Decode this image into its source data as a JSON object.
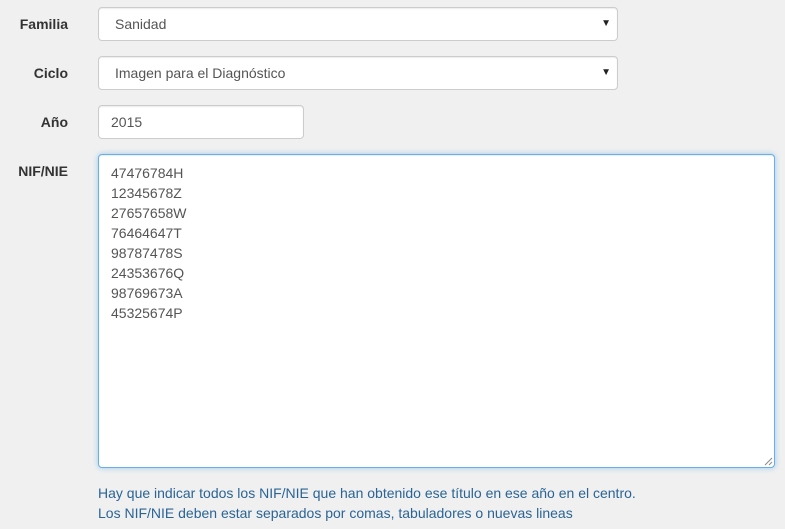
{
  "form": {
    "familia": {
      "label": "Familia",
      "selected": "Sanidad"
    },
    "ciclo": {
      "label": "Ciclo",
      "selected": "Imagen para el Diagnóstico"
    },
    "anio": {
      "label": "Año",
      "value": "2015"
    },
    "nif": {
      "label": "NIF/NIE",
      "value": "47476784H\n12345678Z\n27657658W\n76464647T\n98787478S\n24353676Q\n98769673A\n45325674P",
      "help_line_1": "Hay que indicar todos los NIF/NIE que han obtenido ese título en ese año en el centro.",
      "help_line_2": "Los NIF/NIE deben estar separados por comas, tabuladores o nuevas lineas"
    }
  },
  "icons": {
    "dropdown": "chevron-down-icon",
    "resize": "resize-grip-icon"
  },
  "colors": {
    "background": "#f0f0f0",
    "focus_border": "#66afe9",
    "help_text": "#2a6496"
  }
}
